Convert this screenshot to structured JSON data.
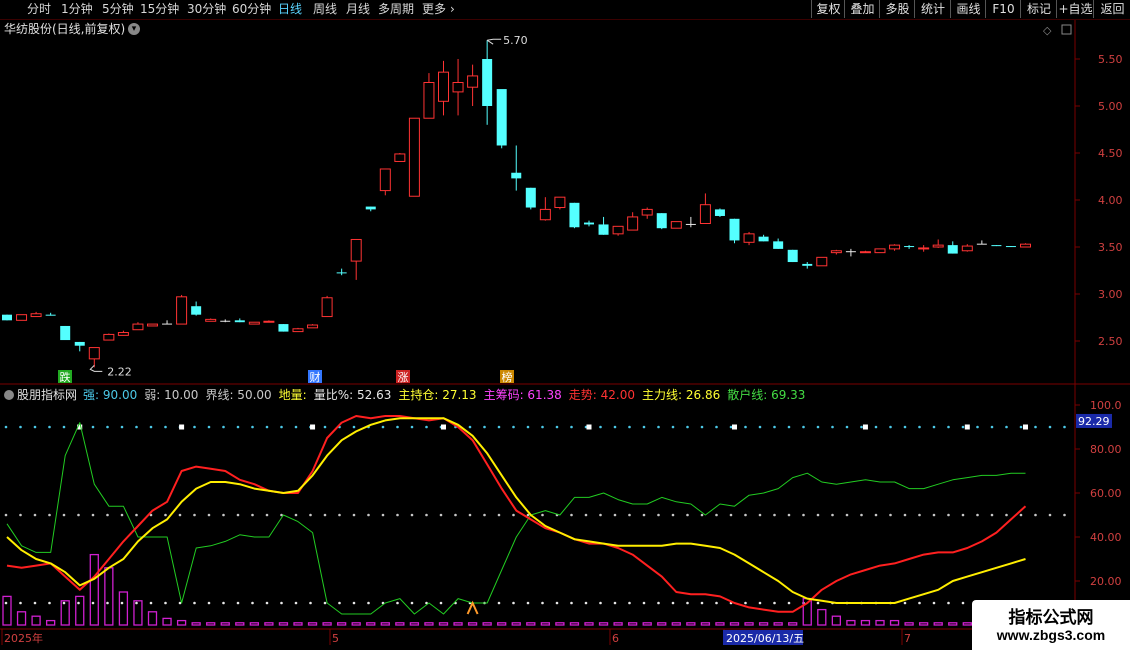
{
  "toolbar": {
    "periods": [
      "分时",
      "1分钟",
      "5分钟",
      "15分钟",
      "30分钟",
      "60分钟",
      "日线",
      "周线",
      "月线",
      "多周期",
      "更多"
    ],
    "active_period": "日线",
    "more_arrow": "›",
    "right_buttons": [
      "复权",
      "叠加",
      "多股",
      "统计",
      "画线",
      "F10",
      "标记",
      "+自选",
      "返回"
    ]
  },
  "stock": {
    "title": "华纺股份(日线,前复权)",
    "dropdown_icon": "chevron-down-icon"
  },
  "price_panel": {
    "y_ticks": [
      "5.50",
      "5.00",
      "4.50",
      "4.00",
      "3.50",
      "3.00",
      "2.50"
    ],
    "high_label": "5.70",
    "low_label": "2.22",
    "markers": [
      {
        "text": "跌",
        "color": "#22aa22"
      },
      {
        "text": "财",
        "color": "#3377ff"
      },
      {
        "text": "涨",
        "color": "#cc2222"
      },
      {
        "text": "榜",
        "color": "#cc8800"
      }
    ],
    "candles": [
      [
        2.78,
        2.78,
        2.72,
        2.72
      ],
      [
        2.72,
        2.78,
        2.72,
        2.78
      ],
      [
        2.76,
        2.81,
        2.76,
        2.79
      ],
      [
        2.78,
        2.8,
        2.77,
        2.77
      ],
      [
        2.66,
        2.66,
        2.56,
        2.51
      ],
      [
        2.49,
        2.49,
        2.39,
        2.45
      ],
      [
        2.31,
        2.43,
        2.22,
        2.43
      ],
      [
        2.51,
        2.58,
        2.51,
        2.57
      ],
      [
        2.56,
        2.61,
        2.56,
        2.59
      ],
      [
        2.62,
        2.7,
        2.62,
        2.68
      ],
      [
        2.66,
        2.68,
        2.66,
        2.68
      ],
      [
        2.68,
        2.72,
        2.68,
        2.68
      ],
      [
        2.68,
        2.99,
        2.68,
        2.97
      ],
      [
        2.87,
        2.92,
        2.77,
        2.78
      ],
      [
        2.71,
        2.74,
        2.71,
        2.73
      ],
      [
        2.71,
        2.73,
        2.7,
        2.71
      ],
      [
        2.72,
        2.74,
        2.7,
        2.7
      ],
      [
        2.68,
        2.7,
        2.68,
        2.7
      ],
      [
        2.7,
        2.72,
        2.7,
        2.71
      ],
      [
        2.68,
        2.68,
        2.6,
        2.6
      ],
      [
        2.6,
        2.64,
        2.6,
        2.63
      ],
      [
        2.64,
        2.68,
        2.64,
        2.67
      ],
      [
        2.76,
        2.98,
        2.76,
        2.96
      ],
      [
        3.23,
        3.27,
        3.2,
        3.22
      ],
      [
        3.35,
        3.58,
        3.15,
        3.58
      ],
      [
        3.93,
        3.93,
        3.88,
        3.9
      ],
      [
        4.1,
        4.33,
        4.05,
        4.33
      ],
      [
        4.41,
        4.5,
        4.41,
        4.49
      ],
      [
        4.04,
        4.87,
        4.04,
        4.87
      ],
      [
        4.87,
        5.35,
        4.87,
        5.25
      ],
      [
        5.05,
        5.48,
        4.9,
        5.36
      ],
      [
        5.15,
        5.5,
        4.9,
        5.25
      ],
      [
        5.2,
        5.44,
        5.0,
        5.32
      ],
      [
        5.5,
        5.7,
        4.8,
        5.0
      ],
      [
        5.18,
        5.16,
        4.55,
        4.58
      ],
      [
        4.29,
        4.58,
        4.1,
        4.23
      ],
      [
        4.13,
        4.13,
        3.9,
        3.92
      ],
      [
        3.79,
        4.03,
        3.78,
        3.9
      ],
      [
        3.92,
        4.03,
        3.9,
        4.03
      ],
      [
        3.97,
        3.97,
        3.7,
        3.71
      ],
      [
        3.76,
        3.78,
        3.72,
        3.74
      ],
      [
        3.74,
        3.82,
        3.63,
        3.63
      ],
      [
        3.64,
        3.72,
        3.62,
        3.72
      ],
      [
        3.68,
        3.87,
        3.68,
        3.82
      ],
      [
        3.84,
        3.92,
        3.8,
        3.9
      ],
      [
        3.86,
        3.86,
        3.69,
        3.7
      ],
      [
        3.7,
        3.77,
        3.7,
        3.77
      ],
      [
        3.74,
        3.82,
        3.71,
        3.74
      ],
      [
        3.75,
        4.07,
        3.75,
        3.95
      ],
      [
        3.9,
        3.91,
        3.82,
        3.83
      ],
      [
        3.8,
        3.8,
        3.54,
        3.57
      ],
      [
        3.55,
        3.66,
        3.52,
        3.64
      ],
      [
        3.61,
        3.63,
        3.56,
        3.56
      ],
      [
        3.56,
        3.59,
        3.48,
        3.48
      ],
      [
        3.47,
        3.47,
        3.34,
        3.34
      ],
      [
        3.32,
        3.34,
        3.27,
        3.3
      ],
      [
        3.3,
        3.39,
        3.3,
        3.39
      ],
      [
        3.44,
        3.47,
        3.42,
        3.46
      ],
      [
        3.45,
        3.48,
        3.4,
        3.45
      ],
      [
        3.44,
        3.46,
        3.44,
        3.45
      ],
      [
        3.44,
        3.48,
        3.44,
        3.48
      ],
      [
        3.48,
        3.53,
        3.46,
        3.52
      ],
      [
        3.51,
        3.52,
        3.48,
        3.5
      ],
      [
        3.48,
        3.52,
        3.45,
        3.49
      ],
      [
        3.5,
        3.58,
        3.49,
        3.52
      ],
      [
        3.52,
        3.56,
        3.43,
        3.43
      ],
      [
        3.46,
        3.53,
        3.45,
        3.51
      ],
      [
        3.53,
        3.57,
        3.53,
        3.53
      ],
      [
        3.52,
        3.52,
        3.51,
        3.51
      ],
      [
        3.51,
        3.51,
        3.5,
        3.5
      ],
      [
        3.5,
        3.54,
        3.5,
        3.53
      ]
    ]
  },
  "indicator": {
    "name": "股朋指标网",
    "legend": [
      {
        "text": "强: 90.00",
        "color": "#4cc9e8"
      },
      {
        "text": "弱: 10.00",
        "color": "#c8c8c8"
      },
      {
        "text": "界线: 50.00",
        "color": "#c8c8c8"
      },
      {
        "text": "地量:",
        "color": "#ffff33"
      },
      {
        "text": "量比%: 52.63",
        "color": "#e8e8e8"
      },
      {
        "text": "主持仓: 27.13",
        "color": "#ffff33"
      },
      {
        "text": "主筹码: 61.38",
        "color": "#ff44ff"
      },
      {
        "text": "走势: 42.00",
        "color": "#ff3333"
      },
      {
        "text": "主力线: 26.86",
        "color": "#ffff33"
      },
      {
        "text": "散户线: 69.33",
        "color": "#44dd44"
      }
    ],
    "y_ticks": [
      "100.0",
      "80.00",
      "60.00",
      "40.00",
      "20.00"
    ],
    "current_badge": "92.29",
    "date_labels": [
      "2025年",
      "5",
      "6",
      "2025/06/13/五",
      "7"
    ],
    "red_line": [
      27,
      26,
      27,
      28,
      22,
      16,
      22,
      30,
      38,
      45,
      52,
      56,
      70,
      72,
      71,
      70,
      66,
      64,
      61,
      60,
      60,
      70,
      85,
      92,
      95,
      94,
      95,
      95,
      94,
      93,
      94,
      90,
      84,
      73,
      62,
      52,
      48,
      44,
      42,
      39,
      37,
      37,
      35,
      32,
      27,
      22,
      15,
      14,
      14,
      13,
      10,
      8,
      7,
      6,
      6,
      10,
      16,
      20,
      23,
      25,
      27,
      28,
      30,
      32,
      33,
      33,
      35,
      38,
      42,
      48,
      54
    ],
    "yellow_line": [
      40,
      34,
      30,
      28,
      24,
      18,
      21,
      26,
      30,
      38,
      44,
      48,
      56,
      62,
      65,
      65,
      64,
      62,
      61,
      60,
      61,
      68,
      77,
      84,
      88,
      91,
      93,
      94,
      94,
      94,
      94,
      91,
      86,
      78,
      68,
      58,
      50,
      45,
      42,
      39,
      38,
      37,
      36,
      36,
      36,
      36,
      37,
      37,
      36,
      35,
      32,
      28,
      24,
      20,
      15,
      12,
      11,
      10,
      10,
      10,
      10,
      10,
      12,
      14,
      16,
      20,
      22,
      24,
      26,
      28,
      30
    ],
    "green_line": [
      46,
      36,
      33,
      33,
      77,
      92,
      64,
      54,
      54,
      40,
      40,
      40,
      10,
      35,
      36,
      38,
      41,
      40,
      40,
      50,
      47,
      42,
      10,
      5,
      5,
      5,
      10,
      12,
      5,
      10,
      5,
      12,
      10,
      10,
      25,
      40,
      50,
      52,
      50,
      58,
      58,
      60,
      57,
      55,
      55,
      58,
      56,
      55,
      50,
      55,
      54,
      59,
      60,
      62,
      67,
      69,
      65,
      64,
      65,
      66,
      65,
      65,
      62,
      62,
      64,
      66,
      67,
      68,
      68,
      69,
      69
    ],
    "bars": [
      13,
      6,
      4,
      2,
      11,
      13,
      32,
      26,
      15,
      11,
      6,
      3,
      2,
      1,
      1,
      1,
      1,
      1,
      1,
      1,
      1,
      1,
      1,
      1,
      1,
      1,
      1,
      1,
      1,
      1,
      1,
      1,
      1,
      1,
      1,
      1,
      1,
      1,
      1,
      1,
      1,
      1,
      1,
      1,
      1,
      1,
      1,
      1,
      1,
      1,
      1,
      1,
      1,
      1,
      1,
      12,
      7,
      4,
      2,
      2,
      2,
      2,
      1,
      1,
      1,
      1,
      1,
      1,
      1,
      1,
      1
    ],
    "top_markers": [
      5,
      12,
      21,
      30,
      40,
      50,
      59,
      66,
      70
    ],
    "buy_marker_index": 32
  },
  "watermark": {
    "line1": "指标公式网",
    "line2": "www.zbgs3.com"
  },
  "colors": {
    "up": "#ff3333",
    "down": "#54ffff",
    "axis": "#7a0000"
  }
}
